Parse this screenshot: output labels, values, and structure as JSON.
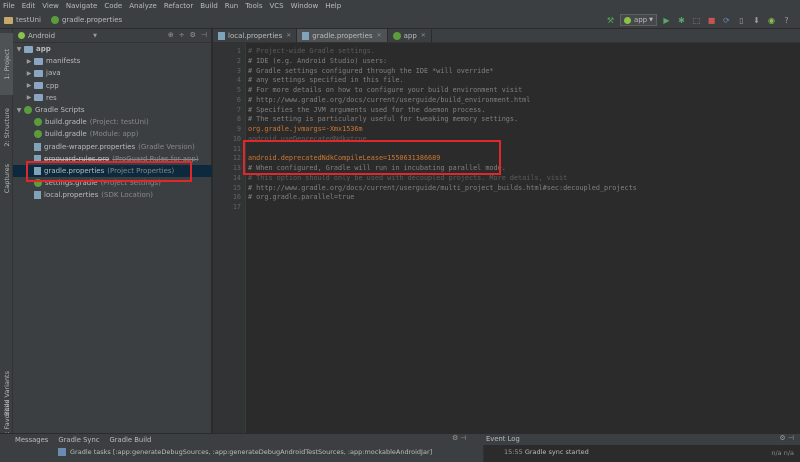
{
  "menubar": [
    "File",
    "Edit",
    "View",
    "Navigate",
    "Code",
    "Analyze",
    "Refactor",
    "Build",
    "Run",
    "Tools",
    "VCS",
    "Window",
    "Help"
  ],
  "breadcrumb": {
    "project": "testUni",
    "file": "gradle.properties"
  },
  "toolbar": {
    "run_config": "app"
  },
  "left_strip": [
    "1: Project",
    "2: Structure",
    "Captures",
    "Build Variants",
    "2: Favorites"
  ],
  "project_panel": {
    "view_mode": "Android",
    "tree": [
      {
        "label": "app",
        "note": ""
      },
      {
        "label": "manifests",
        "note": ""
      },
      {
        "label": "java",
        "note": ""
      },
      {
        "label": "cpp",
        "note": ""
      },
      {
        "label": "res",
        "note": ""
      },
      {
        "label": "Gradle Scripts",
        "note": ""
      },
      {
        "label": "build.gradle",
        "note": "(Project: testUni)"
      },
      {
        "label": "build.gradle",
        "note": "(Module: app)"
      },
      {
        "label": "gradle-wrapper.properties",
        "note": "(Gradle Version)"
      },
      {
        "label": "proguard-rules.pro",
        "note": "(ProGuard Rules for app)"
      },
      {
        "label": "gradle.properties",
        "note": "(Project Properties)"
      },
      {
        "label": "settings.gradle",
        "note": "(Project Settings)"
      },
      {
        "label": "local.properties",
        "note": "(SDK Location)"
      }
    ]
  },
  "editor": {
    "tabs": [
      "local.properties",
      "gradle.properties",
      "app"
    ],
    "line_numbers": [
      "1",
      "2",
      "3",
      "4",
      "5",
      "6",
      "7",
      "8",
      "9",
      "10",
      "11",
      "12",
      "13",
      "14",
      "15",
      "16",
      "17"
    ],
    "lines": [
      "# Project-wide Gradle settings.",
      "# IDE (e.g. Android Studio) users:",
      "# Gradle settings configured through the IDE *will override*",
      "# any settings specified in this file.",
      "# For more details on how to configure your build environment visit",
      "# http://www.gradle.org/docs/current/userguide/build_environment.html",
      "# Specifies the JVM arguments used for the daemon process.",
      "# The setting is particularly useful for tweaking memory settings.",
      "org.gradle.jvmargs=-Xmx1536m",
      "android.useDeprecatedNdk=true",
      "",
      "android.deprecatedNdkCompileLease=1550631386689",
      "# When configured, Gradle will run in incubating parallel mode.",
      "# This option should only be used with decoupled projects. More details, visit",
      "# http://www.gradle.org/docs/current/userguide/multi_project_builds.html#sec:decoupled_projects",
      "# org.gradle.parallel=true",
      ""
    ]
  },
  "bottom_tabs": [
    "Messages",
    "Gradle Sync",
    "Gradle Build"
  ],
  "event_log": {
    "title": "Event Log",
    "time": "15:55",
    "message": "Gradle sync started"
  },
  "status": {
    "text": "Gradle tasks [:app:generateDebugSources, :app:generateDebugAndroidTestSources, :app:mockableAndroidJar]",
    "right": "n/a  n/a"
  },
  "colors": {
    "highlight_box": "#e0272a",
    "selection": "#0d293e",
    "property_key": "#cc7832",
    "property_value": "#a5c261"
  }
}
